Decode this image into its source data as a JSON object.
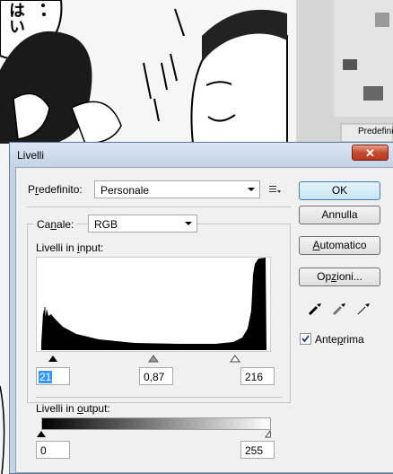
{
  "dialog": {
    "title": "Livelli",
    "close_glyph": "✕"
  },
  "preset": {
    "label_pre": "P",
    "label_u": "r",
    "label_post": "edefinito:",
    "value": "Personale"
  },
  "channel": {
    "label_pre": "Ca",
    "label_u": "n",
    "label_post": "ale:",
    "value": "RGB"
  },
  "input_levels": {
    "label_pre": "Livelli in ",
    "label_u": "i",
    "label_post": "nput:",
    "black": "21",
    "gamma": "0,87",
    "white": "216",
    "black_fraction": 0.082,
    "gamma_fraction": 0.5,
    "white_fraction": 0.847
  },
  "output_levels": {
    "label_pre": "Livelli in ",
    "label_u": "o",
    "label_post": "utput:",
    "black": "0",
    "white": "255"
  },
  "buttons": {
    "ok": "OK",
    "cancel": "Annulla",
    "auto_u": "A",
    "auto_rest": "utomatico",
    "options_pre": "Op",
    "options_u": "z",
    "options_post": "ioni..."
  },
  "preview": {
    "label_pre": "Ante",
    "label_u": "p",
    "label_post": "rima",
    "checked": true
  },
  "background_panel": {
    "tab_label": "Predefini"
  },
  "manga": {
    "bubble_text": "はい"
  },
  "colors": {
    "title_bar": "#c6d4e4",
    "close_button": "#c74a2f",
    "selection": "#3399ff"
  }
}
